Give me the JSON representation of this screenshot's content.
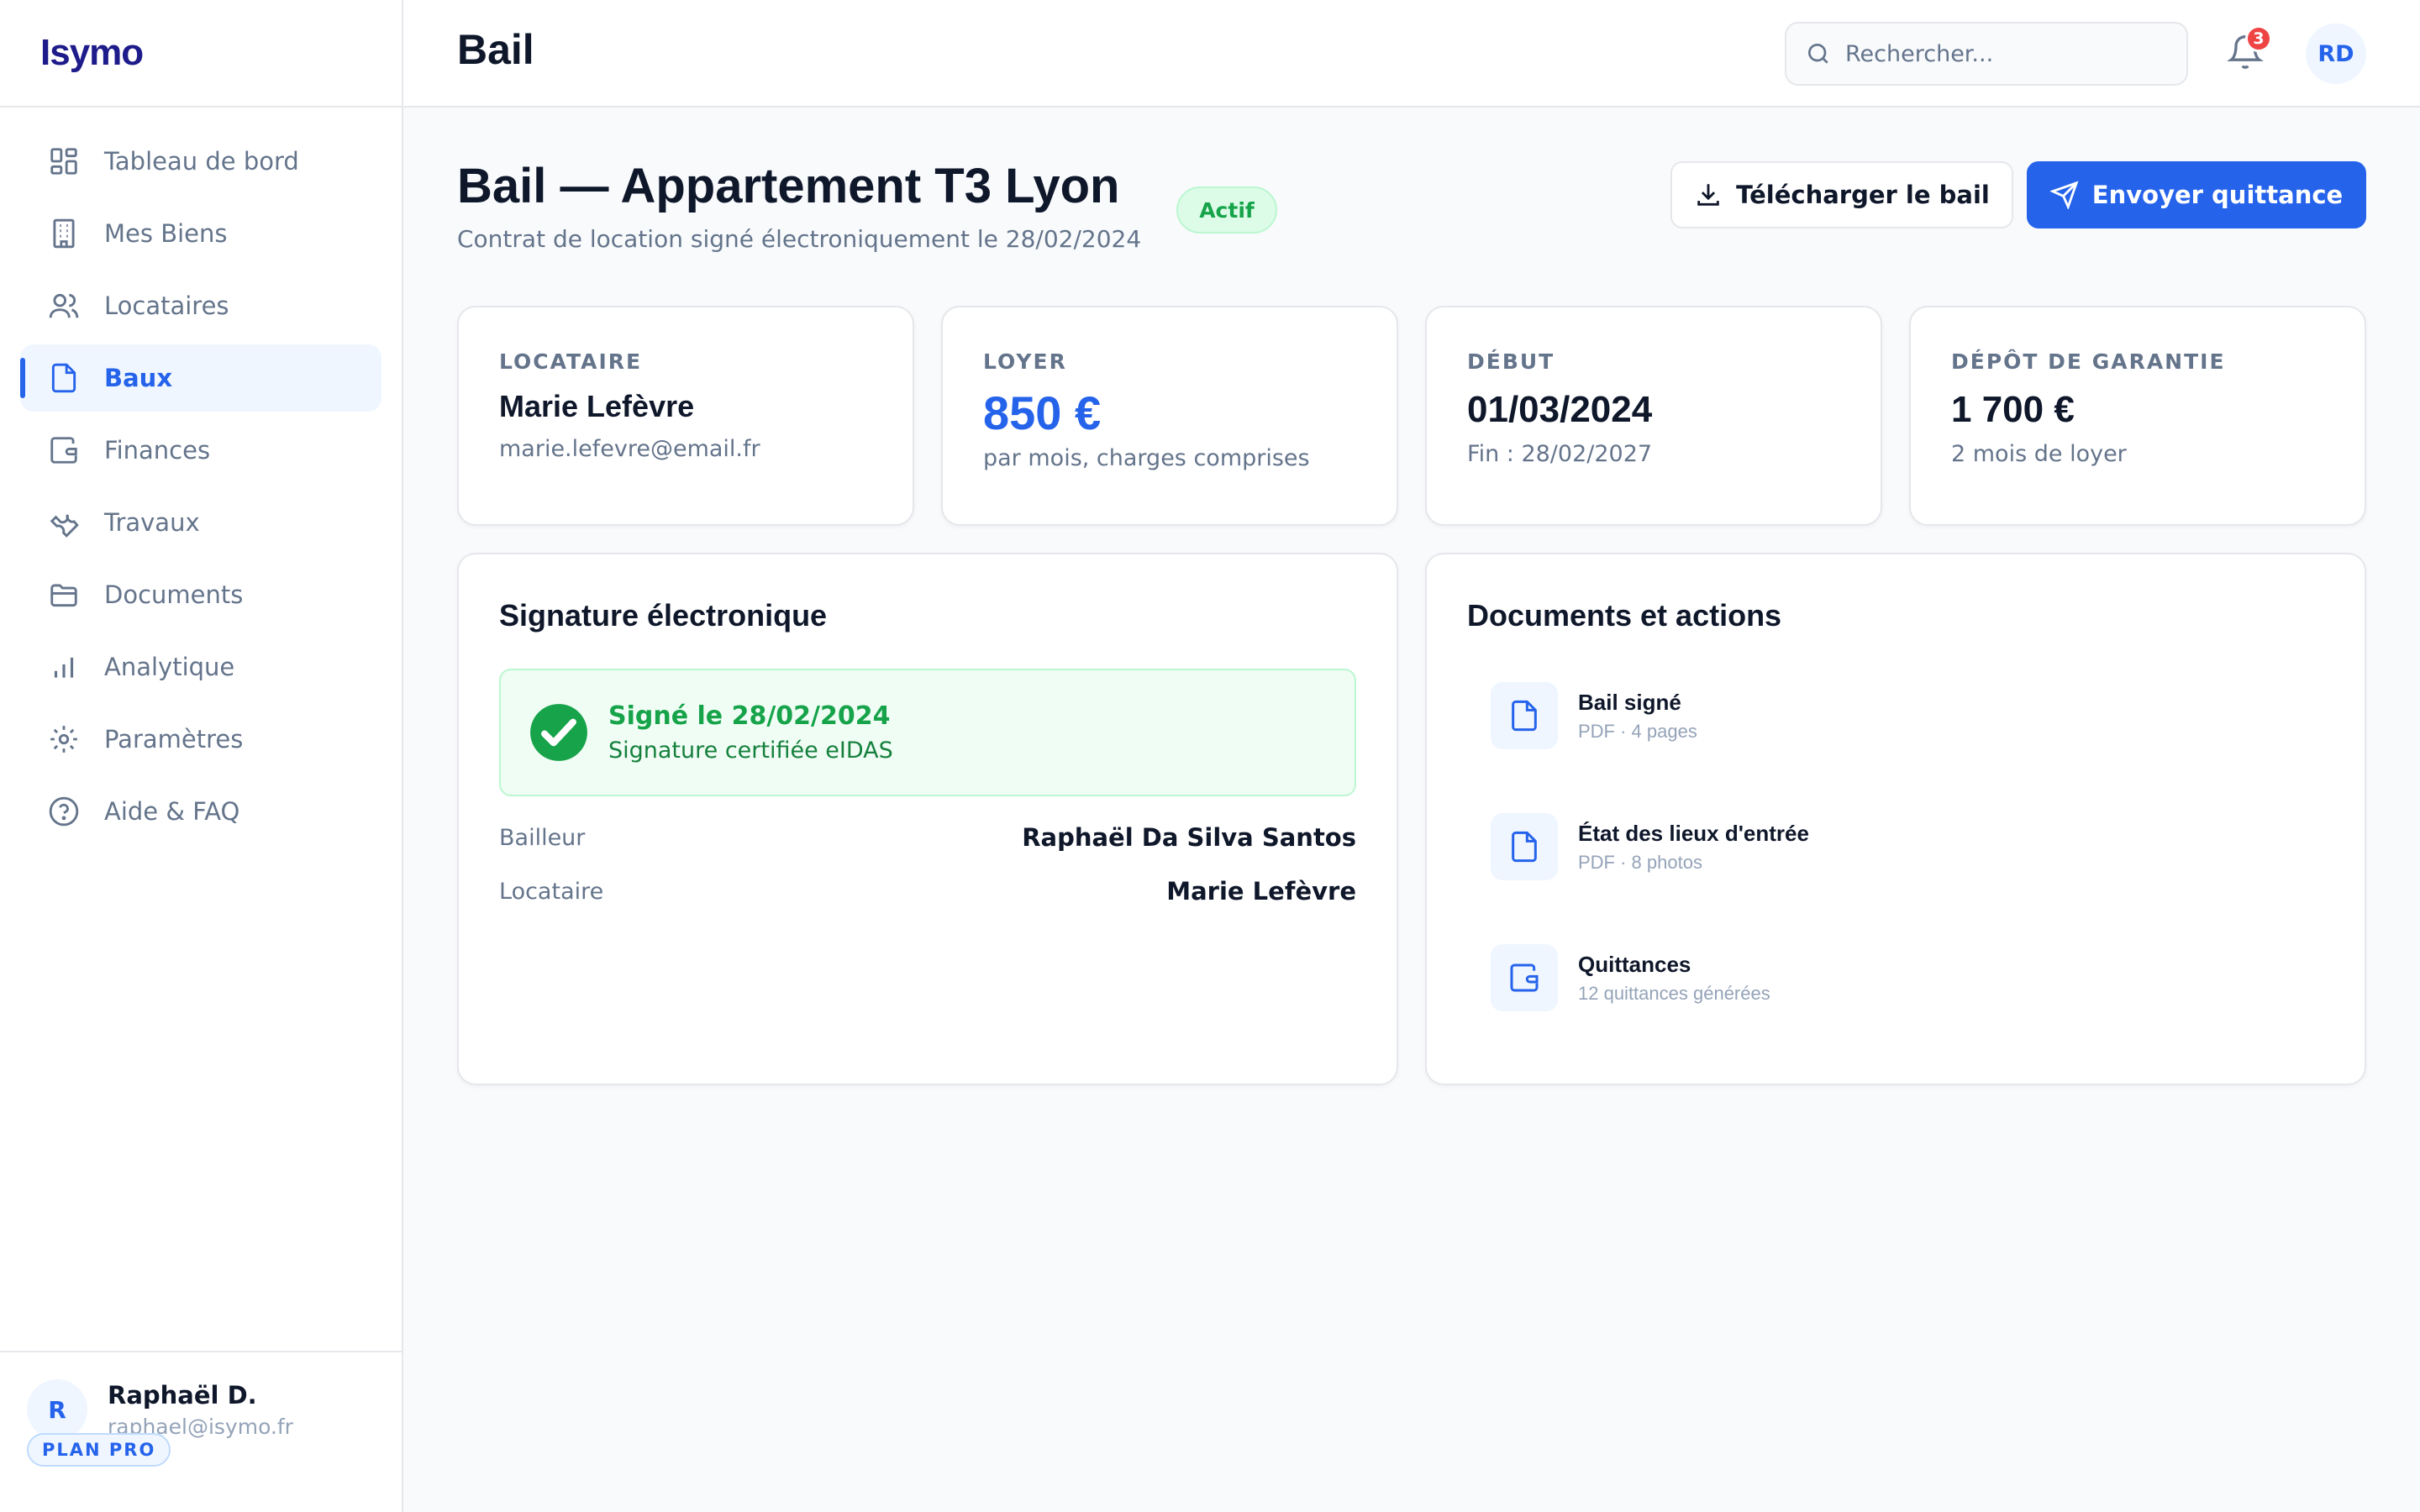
{
  "app": {
    "brand": "Isymo"
  },
  "sidebar": {
    "items": [
      {
        "label": "Tableau de bord",
        "icon": "grid-icon"
      },
      {
        "label": "Mes Biens",
        "icon": "building-icon"
      },
      {
        "label": "Locataires",
        "icon": "users-icon"
      },
      {
        "label": "Baux",
        "icon": "file-icon",
        "active": true
      },
      {
        "label": "Finances",
        "icon": "wallet-icon"
      },
      {
        "label": "Travaux",
        "icon": "wrench-icon"
      },
      {
        "label": "Documents",
        "icon": "folder-icon"
      },
      {
        "label": "Analytique",
        "icon": "bar-chart-icon"
      },
      {
        "label": "Paramètres",
        "icon": "gear-icon"
      },
      {
        "label": "Aide & FAQ",
        "icon": "help-icon"
      }
    ],
    "user": {
      "initial": "R",
      "name": "Raphaël D.",
      "email": "raphael@isymo.fr",
      "plan": "PLAN PRO"
    }
  },
  "header": {
    "title": "Bail",
    "search_placeholder": "Rechercher...",
    "notification_count": "3",
    "avatar_initials": "RD"
  },
  "lease": {
    "title": "Bail — Appartement T3 Lyon",
    "subtitle": "Contrat de location signé électroniquement le 28/02/2024",
    "status": "Actif",
    "download_label": "Télécharger le bail",
    "send_label": "Envoyer quittance"
  },
  "stats": {
    "tenant": {
      "label": "LOCATAIRE",
      "value": "Marie Lefèvre",
      "sub": "marie.lefevre@email.fr"
    },
    "rent": {
      "label": "LOYER",
      "value": "850 €",
      "sub": "par mois, charges comprises"
    },
    "start": {
      "label": "DÉBUT",
      "value": "01/03/2024",
      "sub": "Fin : 28/02/2027"
    },
    "deposit": {
      "label": "DÉPÔT DE GARANTIE",
      "value": "1 700 €",
      "sub": "2 mois de loyer"
    }
  },
  "signature": {
    "title": "Signature électronique",
    "status_title": "Signé le 28/02/2024",
    "status_sub": "Signature certifiée eIDAS",
    "parties": [
      {
        "label": "Bailleur",
        "value": "Raphaël Da Silva Santos"
      },
      {
        "label": "Locataire",
        "value": "Marie Lefèvre"
      }
    ]
  },
  "documents": {
    "title": "Documents et actions",
    "items": [
      {
        "name": "Bail signé",
        "meta": "PDF · 4 pages",
        "icon": "file-icon"
      },
      {
        "name": "État des lieux d'entrée",
        "meta": "PDF · 8 photos",
        "icon": "file-icon"
      },
      {
        "name": "Quittances",
        "meta": "12 quittances générées",
        "icon": "wallet-icon"
      }
    ]
  },
  "colors": {
    "accent": "#2563eb",
    "success": "#16a34a",
    "danger": "#ef4444",
    "brand": "#1e1b8a"
  }
}
